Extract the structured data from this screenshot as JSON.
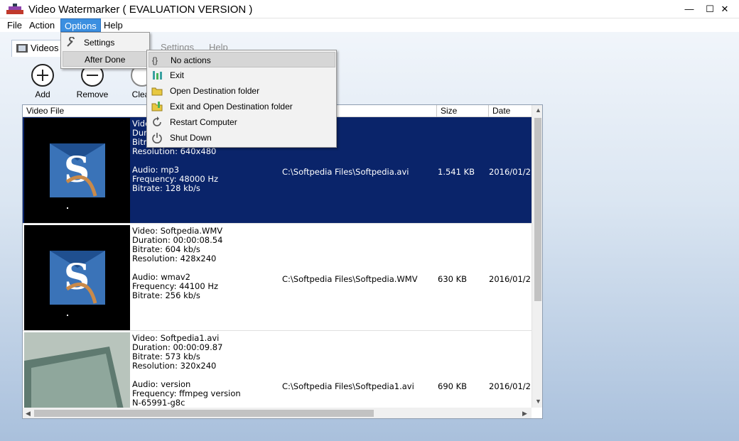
{
  "window": {
    "title": "Video Watermarker ( EVALUATION VERSION )",
    "minimize": "—",
    "maximize": "☐",
    "close": "✕"
  },
  "menubar": {
    "file": "File",
    "action": "Action",
    "options": "Options",
    "help": "Help"
  },
  "tabs": {
    "videos": "Videos",
    "settings": "Settings",
    "help": "Help"
  },
  "toolbar": {
    "add": "Add",
    "remove": "Remove",
    "clear": "Clear"
  },
  "list": {
    "columns": {
      "video_file": "Video File",
      "size": "Size",
      "date": "Date"
    },
    "rows": [
      {
        "info": "Video: Softpedia.avi\nDuration: 00:00:08.54\nBitrate: 1484 kb/s\nResolution: 640x480\n\nAudio: mp3\nFrequency: 48000 Hz\nBitrate: 128 kb/s",
        "path": "C:\\Softpedia Files\\Softpedia.avi",
        "size": "1.541 KB",
        "date": "2016/01/2"
      },
      {
        "info": "Video: Softpedia.WMV\nDuration: 00:00:08.54\nBitrate: 604 kb/s\nResolution: 428x240\n\nAudio: wmav2\nFrequency: 44100 Hz\nBitrate: 256 kb/s",
        "path": "C:\\Softpedia Files\\Softpedia.WMV",
        "size": "630 KB",
        "date": "2016/01/2"
      },
      {
        "info": "Video: Softpedia1.avi\nDuration: 00:00:09.87\nBitrate: 573 kb/s\nResolution: 320x240\n\nAudio: version\nFrequency: ffmpeg version\nN-65991-g8c",
        "path": "C:\\Softpedia Files\\Softpedia1.avi",
        "size": "690 KB",
        "date": "2016/01/2"
      }
    ]
  },
  "options_menu": {
    "settings": "Settings",
    "after_done": "After Done"
  },
  "after_done_menu": {
    "no_actions": "No actions",
    "exit": "Exit",
    "open_destination": "Open Destination folder",
    "exit_open_destination": "Exit and Open Destination folder",
    "restart": "Restart Computer",
    "shutdown": "Shut Down"
  },
  "colors": {
    "selection": "#0a246a",
    "menu_active": "#3b8fe0"
  }
}
